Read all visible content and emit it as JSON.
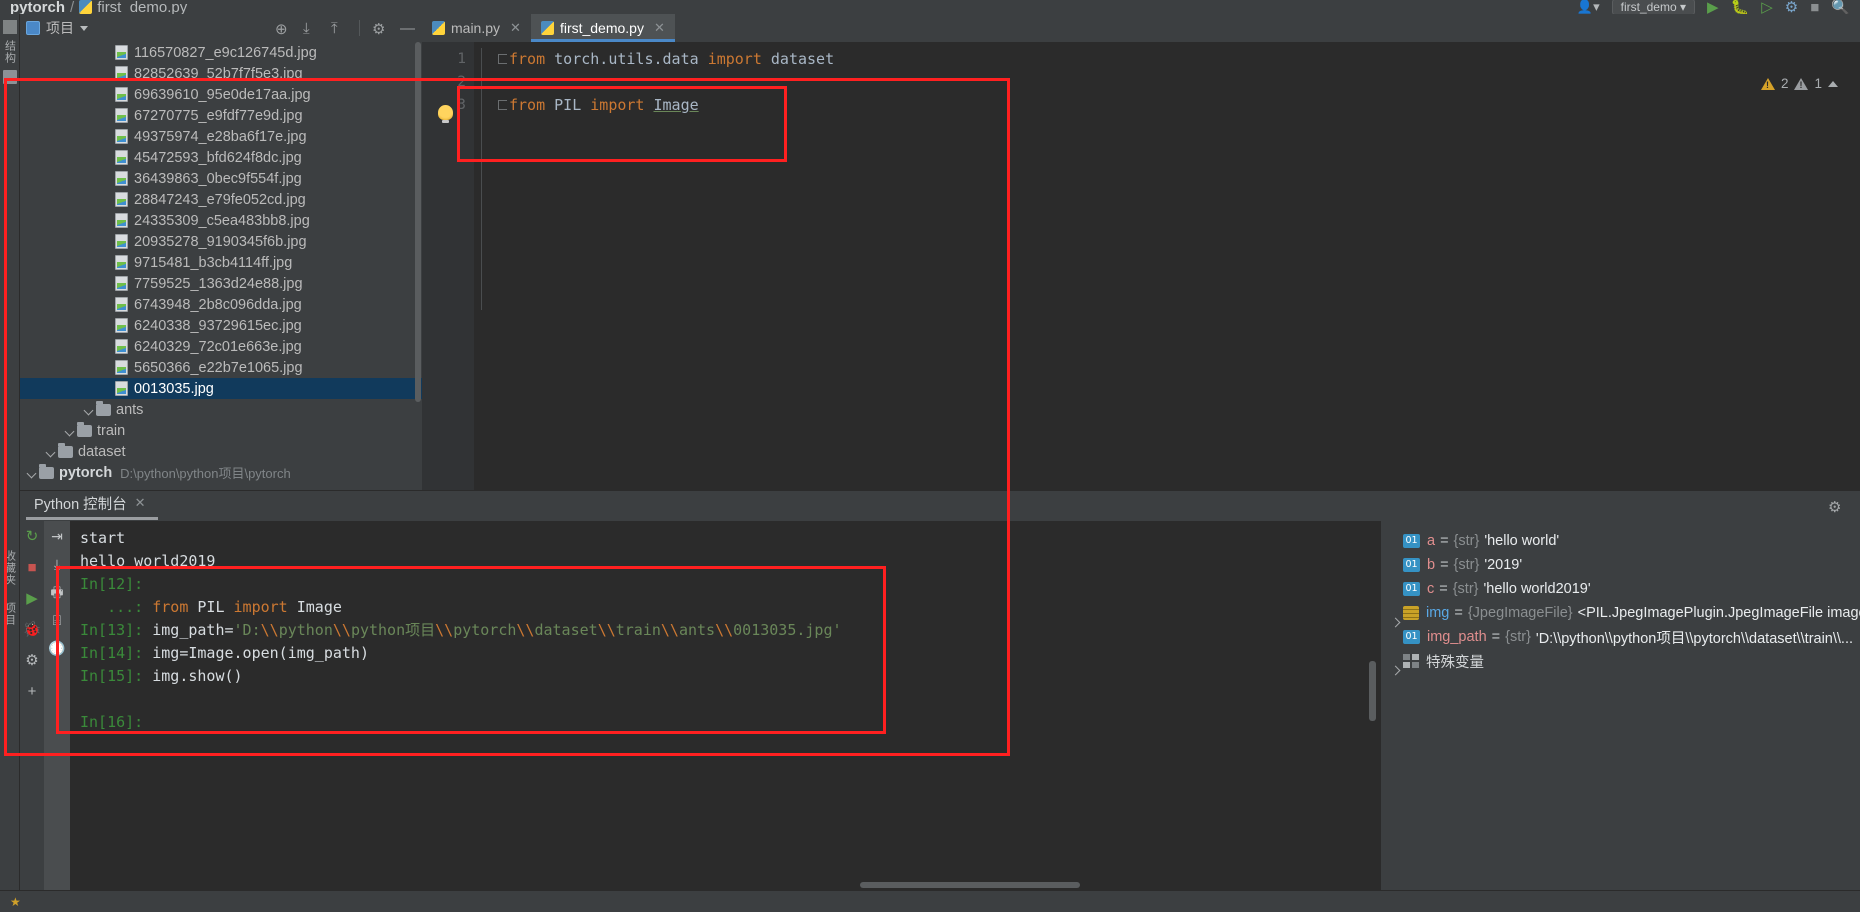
{
  "breadcrumb": {
    "project": "pytorch",
    "separator": "/",
    "file": "first_demo.py",
    "file_icon": "python-file-icon"
  },
  "left_rail": {
    "items": [
      {
        "label": "结构",
        "icon": "structure-icon"
      },
      {
        "label": "项目",
        "icon": "project-icon"
      },
      {
        "label": "收藏夹",
        "icon": "favorites-icon"
      }
    ]
  },
  "project_panel": {
    "title": "项目",
    "title_icon": "project-window-icon",
    "dropdown_icon": "chevron-down-icon",
    "tools": [
      {
        "name": "locate-icon",
        "glyph": "⊕"
      },
      {
        "name": "expand-all-icon",
        "glyph": "⤓"
      },
      {
        "name": "collapse-all-icon",
        "glyph": "⤒"
      },
      {
        "name": "settings-gear-icon",
        "glyph": "⚙"
      },
      {
        "name": "hide-panel-icon",
        "glyph": "—"
      }
    ],
    "tree": [
      {
        "indent": 0,
        "type": "folder",
        "label": "pytorch",
        "bold": true,
        "path": "D:\\python\\python项目\\pytorch",
        "expanded": true,
        "selected": false
      },
      {
        "indent": 1,
        "type": "folder",
        "label": "dataset",
        "bold": false,
        "path": "",
        "expanded": true,
        "selected": false
      },
      {
        "indent": 2,
        "type": "folder",
        "label": "train",
        "bold": false,
        "path": "",
        "expanded": true,
        "selected": false
      },
      {
        "indent": 3,
        "type": "folder",
        "label": "ants",
        "bold": false,
        "path": "",
        "expanded": true,
        "selected": false
      },
      {
        "indent": 4,
        "type": "image",
        "label": "0013035.jpg",
        "selected": true
      },
      {
        "indent": 4,
        "type": "image",
        "label": "5650366_e22b7e1065.jpg",
        "selected": false
      },
      {
        "indent": 4,
        "type": "image",
        "label": "6240329_72c01e663e.jpg",
        "selected": false
      },
      {
        "indent": 4,
        "type": "image",
        "label": "6240338_93729615ec.jpg",
        "selected": false
      },
      {
        "indent": 4,
        "type": "image",
        "label": "6743948_2b8c096dda.jpg",
        "selected": false
      },
      {
        "indent": 4,
        "type": "image",
        "label": "7759525_1363d24e88.jpg",
        "selected": false
      },
      {
        "indent": 4,
        "type": "image",
        "label": "9715481_b3cb4114ff.jpg",
        "selected": false
      },
      {
        "indent": 4,
        "type": "image",
        "label": "20935278_9190345f6b.jpg",
        "selected": false
      },
      {
        "indent": 4,
        "type": "image",
        "label": "24335309_c5ea483bb8.jpg",
        "selected": false
      },
      {
        "indent": 4,
        "type": "image",
        "label": "28847243_e79fe052cd.jpg",
        "selected": false
      },
      {
        "indent": 4,
        "type": "image",
        "label": "36439863_0bec9f554f.jpg",
        "selected": false
      },
      {
        "indent": 4,
        "type": "image",
        "label": "45472593_bfd624f8dc.jpg",
        "selected": false
      },
      {
        "indent": 4,
        "type": "image",
        "label": "49375974_e28ba6f17e.jpg",
        "selected": false
      },
      {
        "indent": 4,
        "type": "image",
        "label": "67270775_e9fdf77e9d.jpg",
        "selected": false
      },
      {
        "indent": 4,
        "type": "image",
        "label": "69639610_95e0de17aa.jpg",
        "selected": false
      },
      {
        "indent": 4,
        "type": "image",
        "label": "82852639_52b7f7f5e3.jpg",
        "selected": false
      },
      {
        "indent": 4,
        "type": "image",
        "label": "116570827_e9c126745d.jpg",
        "selected": false
      }
    ]
  },
  "editor": {
    "tabs": [
      {
        "label": "main.py",
        "active": false,
        "icon": "python-file-icon",
        "close_icon": "close-icon"
      },
      {
        "label": "first_demo.py",
        "active": true,
        "icon": "python-file-icon",
        "close_icon": "close-icon"
      }
    ],
    "line_numbers": [
      "1",
      "2",
      "3"
    ],
    "lines": [
      {
        "n": "1",
        "fold": true,
        "parts": [
          {
            "t": "from",
            "c": "kw"
          },
          {
            "t": " torch.utils.data ",
            "c": "ident"
          },
          {
            "t": "import",
            "c": "kw"
          },
          {
            "t": " dataset",
            "c": "ident"
          }
        ]
      },
      {
        "n": "2",
        "fold": false,
        "parts": []
      },
      {
        "n": "3",
        "fold": true,
        "parts": [
          {
            "t": "from",
            "c": "kw"
          },
          {
            "t": " PIL ",
            "c": "ident"
          },
          {
            "t": "import",
            "c": "kw"
          },
          {
            "t": " ",
            "c": "ident"
          },
          {
            "t": "Image",
            "c": "und"
          }
        ]
      }
    ],
    "intention_bulb_icon": "lightbulb-icon",
    "warnings": {
      "count": "2",
      "icon": "warning-triangle-icon"
    },
    "weak_warnings": {
      "count": "1",
      "icon": "warning-triangle-grey-icon"
    },
    "collapse_icon": "chevron-up-icon"
  },
  "console": {
    "tab_label": "Python 控制台",
    "tab_close_icon": "close-icon",
    "settings_icon": "gear-icon",
    "rail_left": [
      {
        "name": "rerun-icon",
        "glyph": "↻",
        "color": "#5a9e4b"
      },
      {
        "name": "stop-icon",
        "glyph": "■",
        "color": "#c75450"
      },
      {
        "name": "run-icon",
        "glyph": "▶",
        "color": "#5a9e4b"
      },
      {
        "name": "debug-icon",
        "glyph": "🐞",
        "color": "#5a9e4b"
      },
      {
        "name": "settings-icon",
        "glyph": "⚙",
        "color": "#b5b8ba"
      },
      {
        "name": "add-icon",
        "glyph": "+",
        "color": "#b5b8ba"
      }
    ],
    "rail_right": [
      {
        "name": "soft-wrap-icon",
        "glyph": "⇥"
      },
      {
        "name": "scroll-to-end-icon",
        "glyph": "⤓"
      },
      {
        "name": "print-icon",
        "glyph": "🖶"
      },
      {
        "name": "show-variables-icon",
        "glyph": "⌸"
      },
      {
        "name": "history-icon",
        "glyph": "🕐"
      }
    ],
    "output": [
      {
        "kind": "plain",
        "text": "start"
      },
      {
        "kind": "plain",
        "text": "hello world2019"
      },
      {
        "kind": "prompt_only",
        "prompt": "In[12]:",
        "text": ""
      },
      {
        "kind": "cont",
        "prompt": "   ...:",
        "segs": [
          {
            "t": " from ",
            "c": "esc"
          },
          {
            "t": "PIL ",
            "c": "wh"
          },
          {
            "t": "import",
            "c": "esc"
          },
          {
            "t": " Image",
            "c": "wh"
          }
        ]
      },
      {
        "kind": "code",
        "prompt": "In[13]:",
        "segs": [
          {
            "t": " img_path=",
            "c": "wh"
          },
          {
            "t": "'D:",
            "c": "str"
          },
          {
            "t": "\\\\",
            "c": "esc"
          },
          {
            "t": "python",
            "c": "str"
          },
          {
            "t": "\\\\",
            "c": "esc"
          },
          {
            "t": "python项目",
            "c": "str"
          },
          {
            "t": "\\\\",
            "c": "esc"
          },
          {
            "t": "pytorch",
            "c": "str"
          },
          {
            "t": "\\\\",
            "c": "esc"
          },
          {
            "t": "dataset",
            "c": "str"
          },
          {
            "t": "\\\\",
            "c": "esc"
          },
          {
            "t": "train",
            "c": "str"
          },
          {
            "t": "\\\\",
            "c": "esc"
          },
          {
            "t": "ants",
            "c": "str"
          },
          {
            "t": "\\\\",
            "c": "esc"
          },
          {
            "t": "0013035.jpg'",
            "c": "str"
          }
        ]
      },
      {
        "kind": "code",
        "prompt": "In[14]:",
        "segs": [
          {
            "t": " img=Image.open(img_path)",
            "c": "wh"
          }
        ]
      },
      {
        "kind": "code",
        "prompt": "In[15]:",
        "segs": [
          {
            "t": " img.show()",
            "c": "wh"
          }
        ]
      },
      {
        "kind": "blank",
        "text": ""
      },
      {
        "kind": "prompt_only",
        "prompt": "In[16]:",
        "text": ""
      }
    ]
  },
  "variables": [
    {
      "icon": "primitive-01-icon",
      "expand": false,
      "name": "a",
      "name_kind": "str",
      "eq": "=",
      "type": "{str}",
      "value": "'hello world'"
    },
    {
      "icon": "primitive-01-icon",
      "expand": false,
      "name": "b",
      "name_kind": "str",
      "eq": "=",
      "type": "{str}",
      "value": "'2019'"
    },
    {
      "icon": "primitive-01-icon",
      "expand": false,
      "name": "c",
      "name_kind": "str",
      "eq": "=",
      "type": "{str}",
      "value": "'hello world2019'"
    },
    {
      "icon": "object-list-icon",
      "expand": true,
      "name": "img",
      "name_kind": "obj",
      "eq": "=",
      "type": "{JpegImageFile}",
      "value": "<PIL.JpegImagePlugin.JpegImageFile image mo"
    },
    {
      "icon": "primitive-01-icon",
      "expand": false,
      "name": "img_path",
      "name_kind": "str",
      "eq": "=",
      "type": "{str}",
      "value": "'D:\\\\python\\\\python项目\\\\pytorch\\\\dataset\\\\train\\\\..."
    },
    {
      "icon": "special-vars-icon",
      "expand": true,
      "name": "特殊变量",
      "name_kind": "plain",
      "eq": "",
      "type": "",
      "value": ""
    }
  ],
  "annotations": {
    "boxes": [
      {
        "name": "outer-highlight-box",
        "color": "#ff2020"
      },
      {
        "name": "code-import-highlight-box",
        "color": "#ff2020"
      },
      {
        "name": "console-session-highlight-box",
        "color": "#ff2020"
      }
    ]
  },
  "statusbar": {
    "left_icon": "pin-icon"
  }
}
